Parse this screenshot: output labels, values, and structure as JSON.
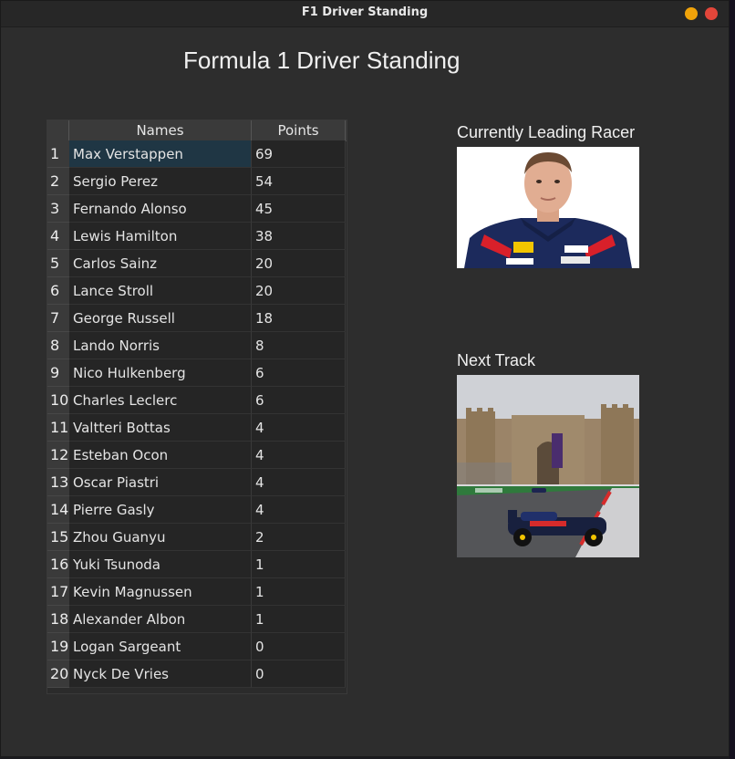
{
  "window": {
    "title": "F1 Driver Standing"
  },
  "app": {
    "heading": "Formula 1 Driver Standing"
  },
  "table": {
    "columns": [
      "Names",
      "Points"
    ],
    "rows": [
      {
        "rank": "1",
        "name": "Max Verstappen",
        "points": "69"
      },
      {
        "rank": "2",
        "name": "Sergio Perez",
        "points": "54"
      },
      {
        "rank": "3",
        "name": "Fernando Alonso",
        "points": "45"
      },
      {
        "rank": "4",
        "name": "Lewis Hamilton",
        "points": "38"
      },
      {
        "rank": "5",
        "name": "Carlos Sainz",
        "points": "20"
      },
      {
        "rank": "6",
        "name": "Lance Stroll",
        "points": "20"
      },
      {
        "rank": "7",
        "name": "George Russell",
        "points": "18"
      },
      {
        "rank": "8",
        "name": "Lando Norris",
        "points": "8"
      },
      {
        "rank": "9",
        "name": "Nico Hulkenberg",
        "points": "6"
      },
      {
        "rank": "10",
        "name": "Charles Leclerc",
        "points": "6"
      },
      {
        "rank": "11",
        "name": "Valtteri Bottas",
        "points": "4"
      },
      {
        "rank": "12",
        "name": "Esteban Ocon",
        "points": "4"
      },
      {
        "rank": "13",
        "name": "Oscar Piastri",
        "points": "4"
      },
      {
        "rank": "14",
        "name": "Pierre Gasly",
        "points": "4"
      },
      {
        "rank": "15",
        "name": "Zhou Guanyu",
        "points": "2"
      },
      {
        "rank": "16",
        "name": "Yuki Tsunoda",
        "points": "1"
      },
      {
        "rank": "17",
        "name": "Kevin Magnussen",
        "points": "1"
      },
      {
        "rank": "18",
        "name": "Alexander Albon",
        "points": "1"
      },
      {
        "rank": "19",
        "name": "Logan Sargeant",
        "points": "0"
      },
      {
        "rank": "20",
        "name": "Nyck De Vries",
        "points": "0"
      }
    ],
    "selected_row": 0
  },
  "leader": {
    "label": "Currently Leading Racer"
  },
  "next_track": {
    "label": "Next Track"
  },
  "colors": {
    "window_bg": "#2d2d2d",
    "minimize_button": "#f0a30a",
    "close_button": "#e2463a",
    "selection": "#1f3644"
  }
}
